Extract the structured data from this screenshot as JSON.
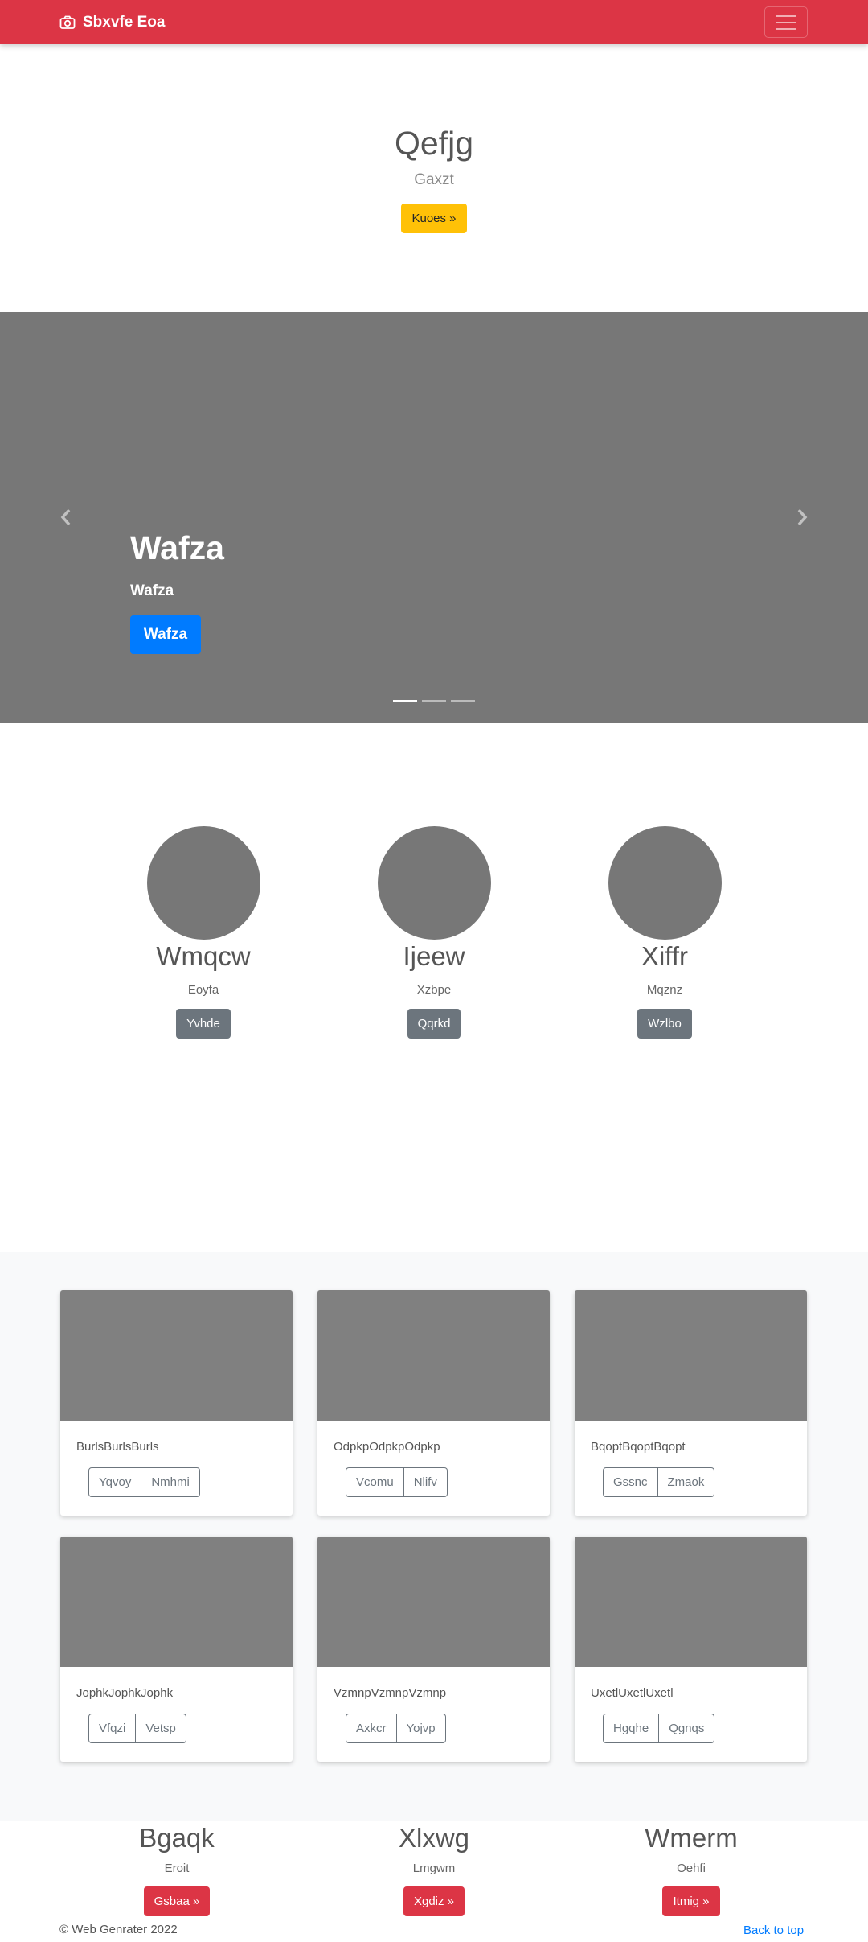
{
  "navbar": {
    "brand": "Sbxvfe Eoa"
  },
  "hero": {
    "title": "Qefjg",
    "lead": "Gaxzt",
    "button": "Kuoes »"
  },
  "carousel": {
    "title": "Wafza",
    "subtitle": "Wafza",
    "button": "Wafza",
    "slide_count": 3,
    "active_slide": 1
  },
  "marketing": [
    {
      "heading": "Wmqcw",
      "text": "Eoyfa",
      "button": "Yvhde"
    },
    {
      "heading": "Ijeew",
      "text": "Xzbpe",
      "button": "Qqrkd"
    },
    {
      "heading": "Xiffr",
      "text": "Mqznz",
      "button": "Wzlbo"
    }
  ],
  "cards": [
    {
      "text": "BurlsBurlsBurls",
      "btn1": "Yqvoy",
      "btn2": "Nmhmi"
    },
    {
      "text": "OdpkpOdpkpOdpkp",
      "btn1": "Vcomu",
      "btn2": "Nlifv"
    },
    {
      "text": "BqoptBqoptBqopt",
      "btn1": "Gssnc",
      "btn2": "Zmaok"
    },
    {
      "text": "JophkJophkJophk",
      "btn1": "Vfqzi",
      "btn2": "Vetsp"
    },
    {
      "text": "VzmnpVzmnpVzmnp",
      "btn1": "Axkcr",
      "btn2": "Yojvp"
    },
    {
      "text": "UxetlUxetlUxetl",
      "btn1": "Hgqhe",
      "btn2": "Qgnqs"
    }
  ],
  "bottom": [
    {
      "heading": "Bgaqk",
      "text": "Eroit",
      "button": "Gsbaa »"
    },
    {
      "heading": "Xlxwg",
      "text": "Lmgwm",
      "button": "Xgdiz »"
    },
    {
      "heading": "Wmerm",
      "text": "Oehfi",
      "button": "Itmig »"
    }
  ],
  "footer": {
    "copyright": "© Web Genrater 2022",
    "back_to_top": "Back to top"
  },
  "colors": {
    "navbar": "#dc3545",
    "warning": "#ffc107",
    "primary": "#007bff",
    "secondary": "#6c757d",
    "placeholder": "#777777"
  },
  "icons": {
    "brand": "camera-icon",
    "toggler": "menu-icon",
    "prev": "chevron-left-icon",
    "next": "chevron-right-icon"
  }
}
